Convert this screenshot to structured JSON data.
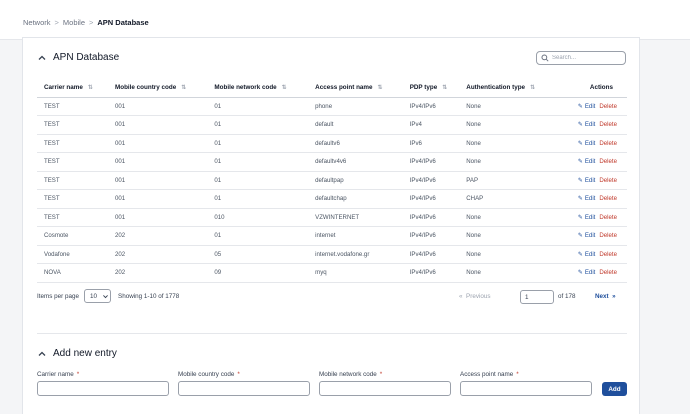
{
  "breadcrumb": {
    "items": [
      "Network",
      "Mobile"
    ],
    "current": "APN Database",
    "separator": ">"
  },
  "apn_section": {
    "title": "APN Database",
    "search_placeholder": "Search...",
    "columns": [
      "Carrier name",
      "Mobile country code",
      "Mobile network code",
      "Access point name",
      "PDP type",
      "Authentication type",
      "Actions"
    ],
    "rows": [
      [
        "TEST",
        "001",
        "01",
        "phone",
        "IPv4/IPv6",
        "None"
      ],
      [
        "TEST",
        "001",
        "01",
        "default",
        "IPv4",
        "None"
      ],
      [
        "TEST",
        "001",
        "01",
        "defaultv6",
        "IPv6",
        "None"
      ],
      [
        "TEST",
        "001",
        "01",
        "defaultv4v6",
        "IPv4/IPv6",
        "None"
      ],
      [
        "TEST",
        "001",
        "01",
        "defaultpap",
        "IPv4/IPv6",
        "PAP"
      ],
      [
        "TEST",
        "001",
        "01",
        "defaultchap",
        "IPv4/IPv6",
        "CHAP"
      ],
      [
        "TEST",
        "001",
        "010",
        "VZWINTERNET",
        "IPv4/IPv6",
        "None"
      ],
      [
        "Cosmote",
        "202",
        "01",
        "internet",
        "IPv4/IPv6",
        "None"
      ],
      [
        "Vodafone",
        "202",
        "05",
        "internet.vodafone.gr",
        "IPv4/IPv6",
        "None"
      ],
      [
        "NOVA",
        "202",
        "09",
        "myq",
        "IPv4/IPv6",
        "None"
      ]
    ],
    "edit_label": "Edit",
    "delete_label": "Delete",
    "pagination": {
      "items_per_page_label": "Items per page",
      "items_per_page_value": "10",
      "showing": "Showing 1-10 of 1778",
      "prev_label": "Previous",
      "page_value": "1",
      "of_label": "of 178",
      "next_label": "Next"
    }
  },
  "add_section": {
    "title": "Add new entry",
    "fields": [
      {
        "label": "Carrier name",
        "value": ""
      },
      {
        "label": "Mobile country code",
        "value": ""
      },
      {
        "label": "Mobile network code",
        "value": ""
      },
      {
        "label": "Access point name",
        "value": ""
      }
    ],
    "required_mark": "*",
    "add_label": "Add"
  },
  "colors": {
    "primary": "#1f4f9c",
    "danger": "#c0392b",
    "muted": "#9ca3af",
    "background": "#f4f5f7"
  },
  "icons": {
    "collapse": "chevron-up-icon",
    "search": "search-icon",
    "edit": "pencil-icon",
    "dropdown": "chevron-down-icon",
    "prev": "double-chevron-left-icon",
    "next": "double-chevron-right-icon"
  }
}
